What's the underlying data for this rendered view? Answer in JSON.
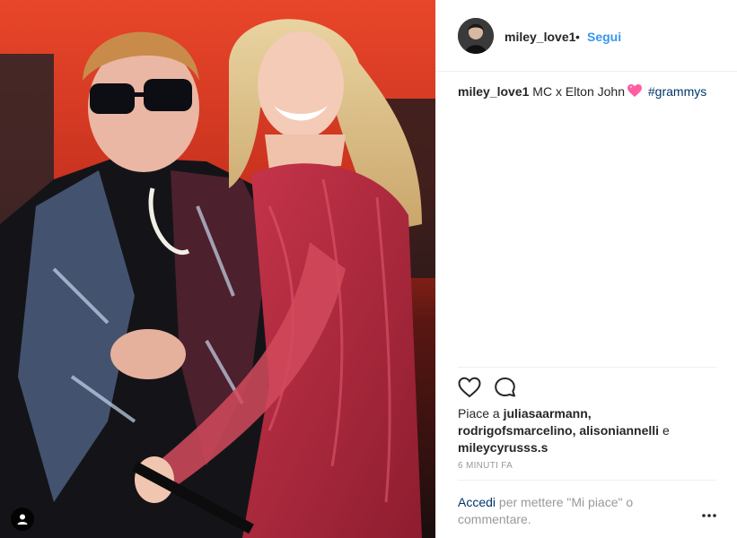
{
  "post": {
    "username": "miley_love1",
    "separator": "•",
    "follow_label": "Segui",
    "caption_text": "MC x Elton John",
    "caption_emoji_icon": "pink-heart-icon",
    "hashtag": "#grammys"
  },
  "actions": {
    "like_icon": "heart-outline-icon",
    "comment_icon": "comment-bubble-icon"
  },
  "likes": {
    "prefix": "Piace a",
    "user1": "juliasaarmann,",
    "user2": "rodrigofsmarcelino,",
    "user3": "alisoniannelli",
    "conjunction": "e",
    "user4": "mileycyrusss.s"
  },
  "timestamp": "6 MINUTI FA",
  "comment_box": {
    "login_label": "Accedi",
    "rest": "per mettere \"Mi piace\" o commentare."
  },
  "colors": {
    "link_blue": "#3897f0",
    "hashtag_navy": "#003569",
    "muted": "#999999",
    "text": "#262626"
  }
}
